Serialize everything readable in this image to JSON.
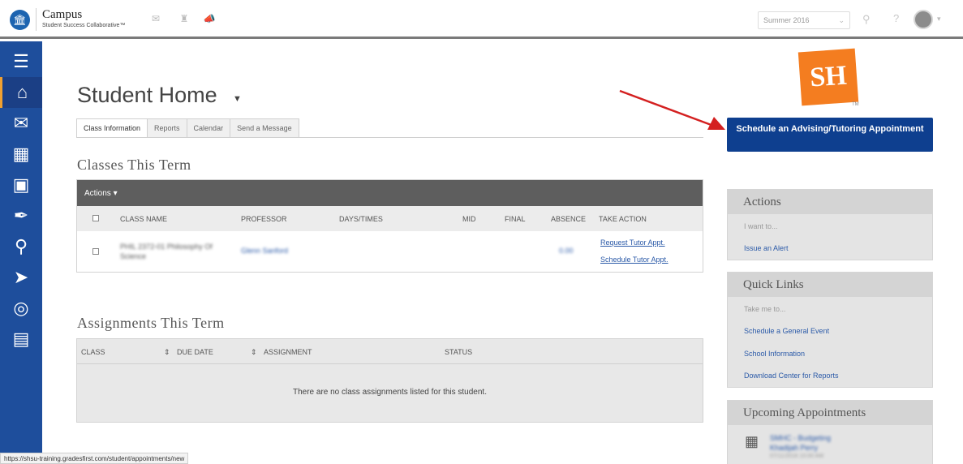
{
  "brand": {
    "title": "Campus",
    "subtitle": "Student Success Collaborative™"
  },
  "header": {
    "term": "Summer 2016"
  },
  "page": {
    "title": "Student Home"
  },
  "tabs": [
    "Class Information",
    "Reports",
    "Calendar",
    "Send a Message"
  ],
  "classes": {
    "title": "Classes This Term",
    "actions_label": "Actions",
    "columns": [
      "CLASS NAME",
      "PROFESSOR",
      "DAYS/TIMES",
      "MID",
      "FINAL",
      "ABSENCE",
      "TAKE ACTION"
    ],
    "rows": [
      {
        "class_name": "PHIL 2372-01 Philosophy Of Science",
        "professor": "Glenn Sanford",
        "absence": "0.00",
        "action1": "Request Tutor Appt.",
        "action2": "Schedule Tutor Appt."
      }
    ]
  },
  "assignments": {
    "title": "Assignments This Term",
    "columns": [
      "CLASS",
      "DUE DATE",
      "ASSIGNMENT",
      "STATUS"
    ],
    "empty": "There are no class assignments listed for this student."
  },
  "schedule_button": "Schedule an Advising/Tutoring Appointment",
  "logo_text": "SH",
  "logo_tm": "TM",
  "actions_widget": {
    "title": "Actions",
    "subtitle": "I want to...",
    "links": [
      "Issue an Alert"
    ]
  },
  "quick_links": {
    "title": "Quick Links",
    "subtitle": "Take me to...",
    "links": [
      "Schedule a General Event",
      "School Information",
      "Download Center for Reports"
    ]
  },
  "upcoming": {
    "title": "Upcoming Appointments",
    "item_line1": "SMHC - Budgeting",
    "item_line2": "Khadijah Perry",
    "item_line3": "07/11/2016 10:00 AM"
  },
  "status_url": "https://shsu-training.gradesfirst.com/student/appointments/new",
  "colors": {
    "nav": "#1e4e9c",
    "button": "#0e3f8f",
    "accent_arrow": "#d42020",
    "logo": "#f47d20"
  },
  "icons": {
    "nav": [
      "menu-icon",
      "home-icon",
      "mail-icon",
      "calendar-icon",
      "folder-icon",
      "pin-icon",
      "search-icon",
      "megaphone-icon",
      "pulse-icon",
      "notes-icon"
    ]
  }
}
